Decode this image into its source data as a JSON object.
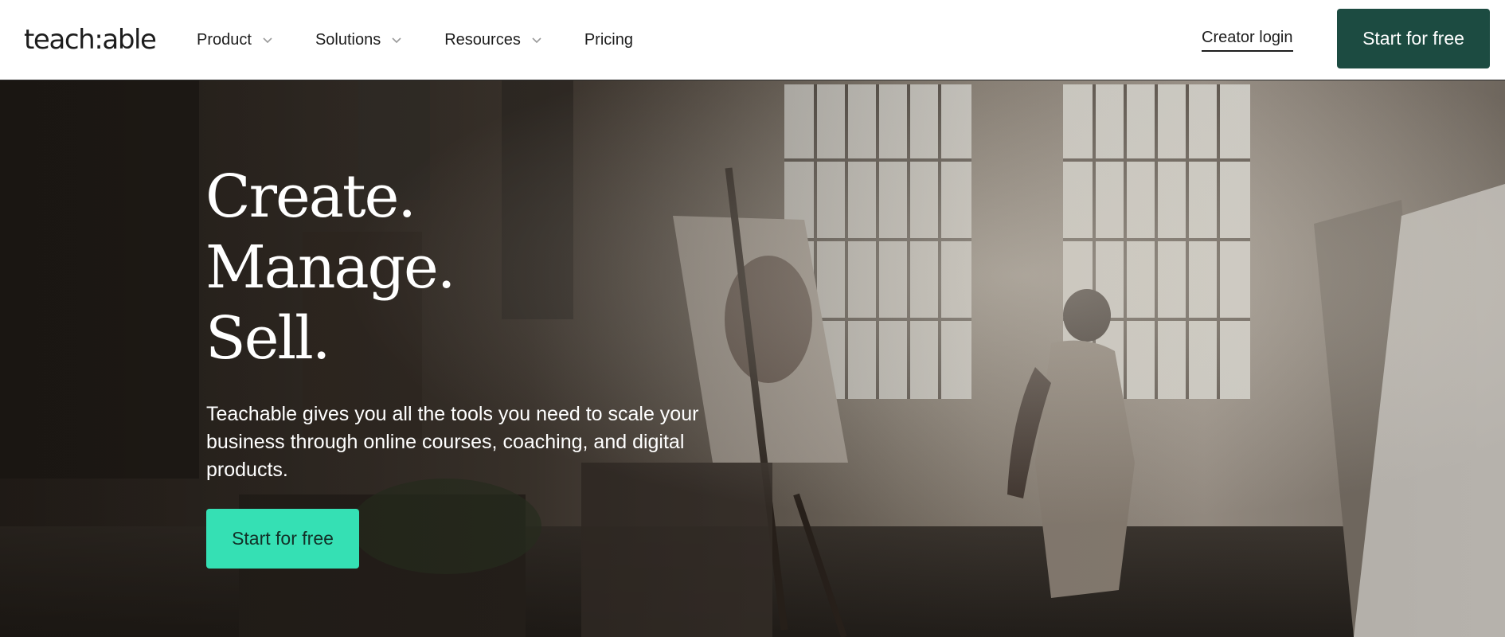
{
  "header": {
    "logo": "teach:able",
    "nav": [
      {
        "label": "Product",
        "has_dropdown": true
      },
      {
        "label": "Solutions",
        "has_dropdown": true
      },
      {
        "label": "Resources",
        "has_dropdown": true
      },
      {
        "label": "Pricing",
        "has_dropdown": false
      }
    ],
    "creator_login": "Creator login",
    "cta": "Start for free",
    "icons": {
      "dropdown": "chevron-down-icon"
    }
  },
  "hero": {
    "headline": [
      "Create.",
      "Manage.",
      "Sell."
    ],
    "subtext": "Teachable gives you all the tools you need to scale your business through online courses, coaching, and digital products.",
    "cta": "Start for free"
  },
  "colors": {
    "header_cta_bg": "#1c4b41",
    "hero_cta_bg": "#35e0b4",
    "text_dark": "#1d1d1d",
    "hero_text": "#ffffff"
  }
}
